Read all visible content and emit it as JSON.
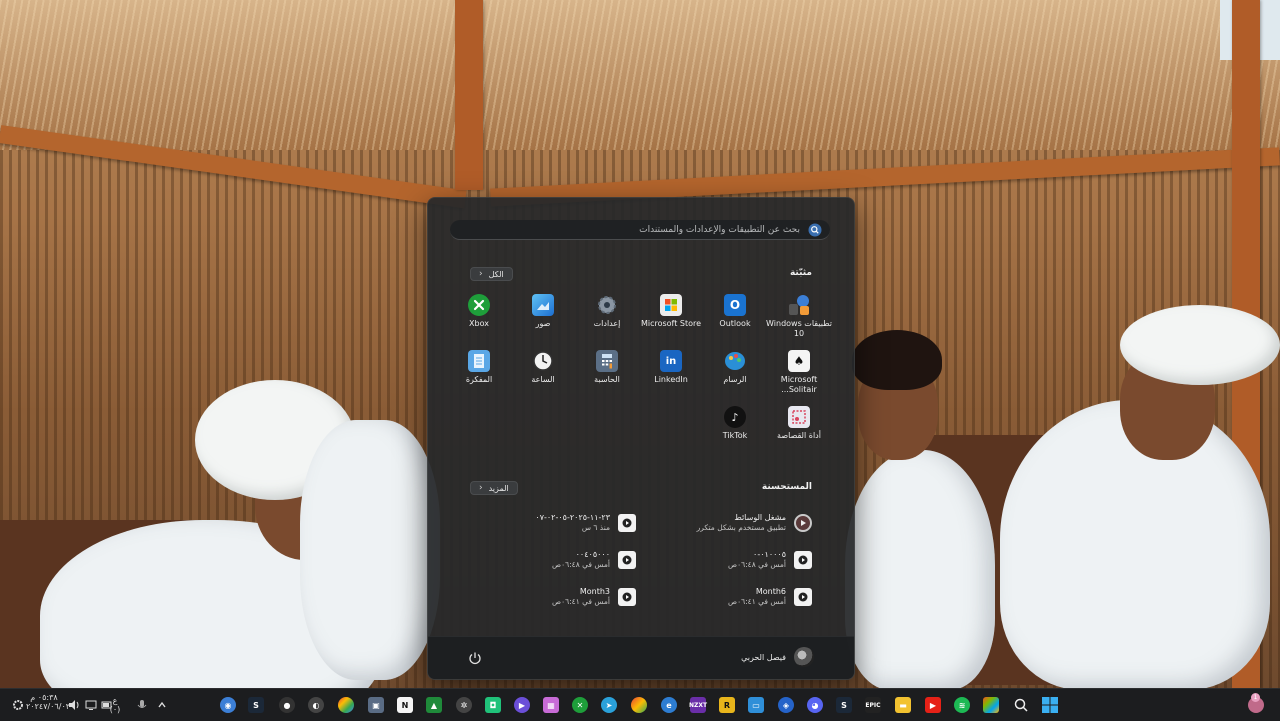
{
  "start_menu": {
    "search_placeholder": "بحث عن التطبيقات والإعدادات والمستندات",
    "pinned": {
      "title": "مثبّتة",
      "all_button": "الكل",
      "apps": [
        {
          "label": "تطبيقات Windows 10",
          "icon": "windows-tools-icon",
          "color": "#3c7fd6"
        },
        {
          "label": "Outlook",
          "icon": "outlook-icon",
          "color": "#1a73d0"
        },
        {
          "label": "Microsoft Store",
          "icon": "store-icon",
          "color": "#ececec"
        },
        {
          "label": "إعدادات",
          "icon": "gear-icon",
          "color": "#7c8794"
        },
        {
          "label": "صور",
          "icon": "photos-icon",
          "color": "#2e8ede"
        },
        {
          "label": "Xbox",
          "icon": "xbox-icon",
          "color": "#1e9e3a"
        },
        {
          "label": "Microsoft Solitair...",
          "icon": "solitaire-icon",
          "color": "#f4f4f4"
        },
        {
          "label": "الرسام",
          "icon": "paint-icon",
          "color": "#2a8fd6"
        },
        {
          "label": "LinkedIn",
          "icon": "linkedin-icon",
          "color": "#1a66c2"
        },
        {
          "label": "الحاسبة",
          "icon": "calculator-icon",
          "color": "#5b6f86"
        },
        {
          "label": "الساعة",
          "icon": "clock-icon",
          "color": "#f2f2f2"
        },
        {
          "label": "المفكرة",
          "icon": "notepad-icon",
          "color": "#5aa7e6"
        },
        {
          "label": "أداة القصاصة",
          "icon": "snipping-tool-icon",
          "color": "#e8e8f0"
        },
        {
          "label": "TikTok",
          "icon": "tiktok-icon",
          "color": "#111111"
        }
      ]
    },
    "recommended": {
      "title": "المستحسنة",
      "more_button": "المزيد",
      "items": [
        {
          "title": "مشغل الوسائط",
          "subtitle": "تطبيق مستخدم بشكل متكرر",
          "icon": "media-player-icon"
        },
        {
          "title": "٢٣-١١-٢٠٢٥-٠٥-٠٢-٠٧",
          "subtitle": "منذ ٦ س",
          "icon": "video-file-icon"
        },
        {
          "title": "٠١٠٠٠٥-٠",
          "subtitle": "أمس في ٠٦:٤٨ص",
          "icon": "video-file-icon"
        },
        {
          "title": "٠٠٤٠٥٠٠٠",
          "subtitle": "أمس في ٠٦:٤٨ص",
          "icon": "video-file-icon"
        },
        {
          "title": "Month6",
          "subtitle": "أمس في ٠٦:٤١ص",
          "icon": "video-file-icon"
        },
        {
          "title": "Month3",
          "subtitle": "أمس في ٠٦:٤١ص",
          "icon": "video-file-icon"
        }
      ]
    },
    "user_name": "فيصل الحربي"
  },
  "taskbar": {
    "clock_time": "٠٥:٣٨ م",
    "clock_date": "٢٠٢٤٧/٠٦/٠٣",
    "language": "ع",
    "language_sub": "(٠)",
    "notification_count": "1",
    "icons": [
      "start-icon",
      "search-icon",
      "chrome-icon",
      "spotify-icon",
      "epic-icon",
      "youtube-icon",
      "file-explorer-icon",
      "epic-games-icon",
      "steam-icon",
      "discord-icon",
      "edge-icon",
      "teams-icon",
      "nzxt-icon",
      "firefox-icon",
      "chrome-icon-2",
      "telegram-icon",
      "xbox-icon",
      "spotlight-icon",
      "edge-icon-2",
      "notion-icon",
      "obs-icon",
      "chrome-icon-3",
      "steam-icon-2"
    ]
  },
  "colors": {
    "start_bg": "#26282a",
    "accent": "#3c7fd6",
    "taskbar_bg": "#1c1d1f"
  }
}
